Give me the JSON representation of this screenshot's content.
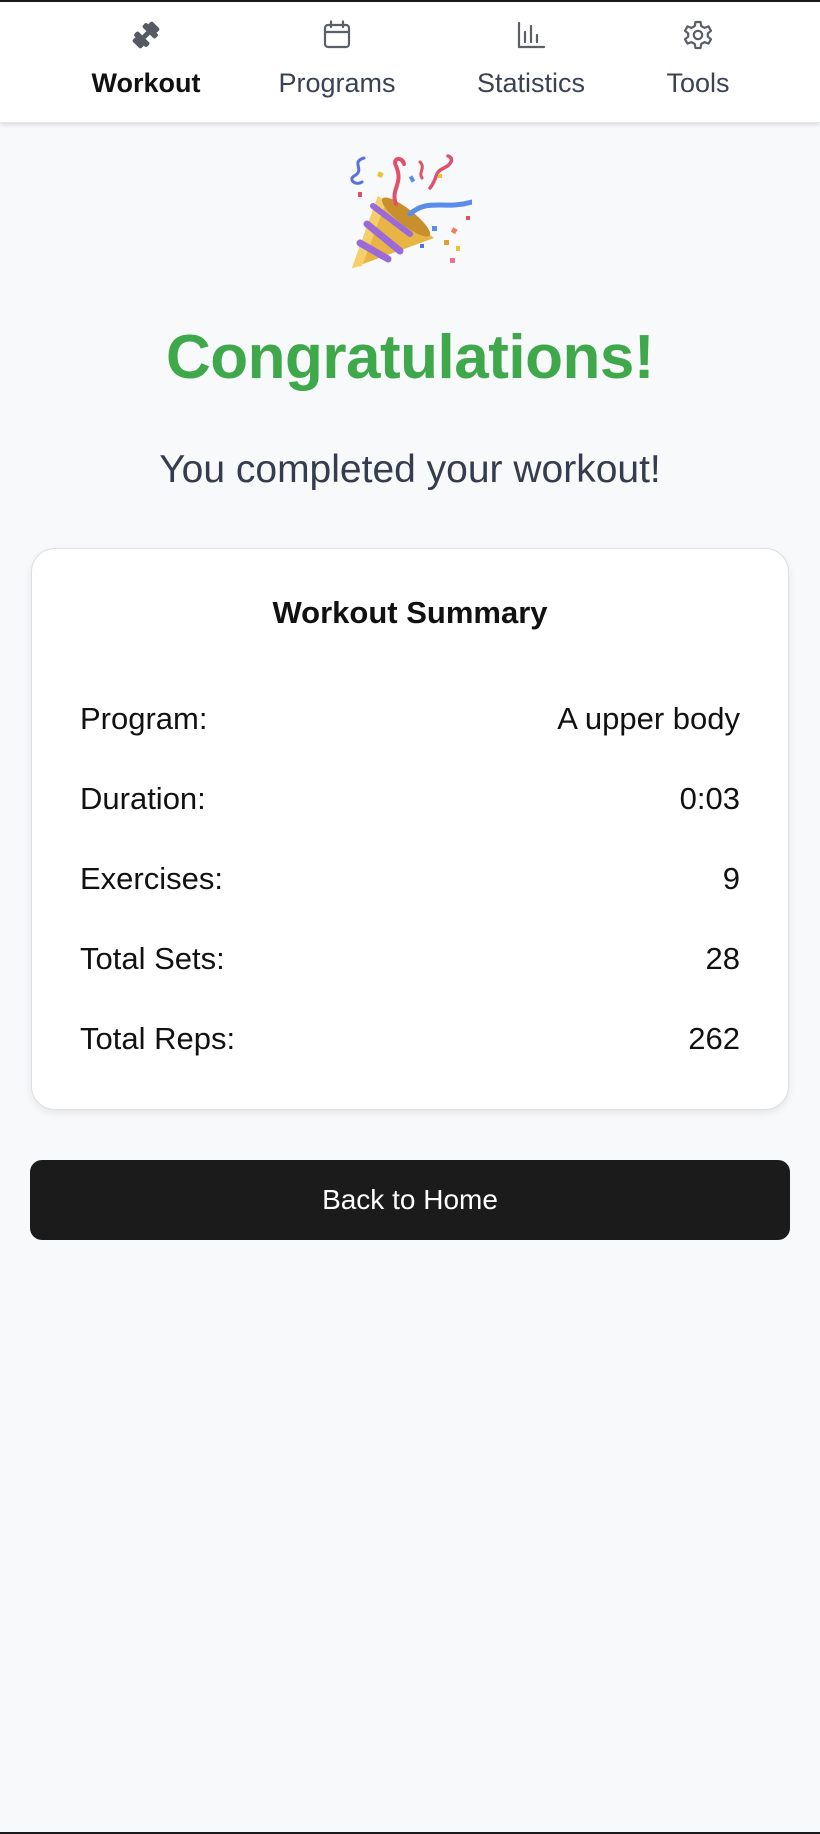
{
  "nav": {
    "items": [
      {
        "label": "Workout",
        "icon": "dumbbell-icon",
        "active": true
      },
      {
        "label": "Programs",
        "icon": "calendar-icon",
        "active": false
      },
      {
        "label": "Statistics",
        "icon": "bar-chart-icon",
        "active": false
      },
      {
        "label": "Tools",
        "icon": "gear-icon",
        "active": false
      }
    ]
  },
  "celebration": {
    "icon": "party-popper-icon",
    "title": "Congratulations!",
    "subtitle": "You completed your workout!"
  },
  "summary": {
    "title": "Workout Summary",
    "rows": [
      {
        "label": "Program:",
        "value": "A upper body"
      },
      {
        "label": "Duration:",
        "value": "0:03"
      },
      {
        "label": "Exercises:",
        "value": "9"
      },
      {
        "label": "Total Sets:",
        "value": "28"
      },
      {
        "label": "Total Reps:",
        "value": "262"
      }
    ]
  },
  "actions": {
    "back_home": "Back to Home"
  },
  "colors": {
    "accent_green": "#3ea84a",
    "button_dark": "#1b1b1b",
    "page_bg": "#f8f9fb"
  }
}
